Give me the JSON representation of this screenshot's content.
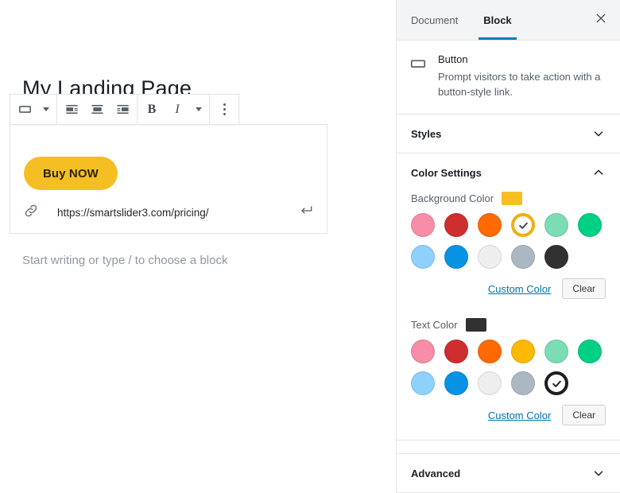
{
  "editor": {
    "post_title": "My Landing Page",
    "placeholder_text": "Start writing or type / to choose a block",
    "toolbar": {
      "block_type_icon": "button-block-icon",
      "block_type_caret_icon": "chevron-down-icon",
      "align_left_icon": "align-left-icon",
      "align_center_icon": "align-center-icon",
      "align_right_icon": "align-right-icon",
      "bold_label": "B",
      "italic_label": "I",
      "more_formatting_icon": "chevron-down-icon",
      "more_options_icon": "kebab-menu-icon"
    },
    "button_block": {
      "label": "Buy NOW",
      "background_color": "#f5bf23",
      "text_color": "#2b2300",
      "link_icon": "link-icon",
      "link_url": "https://smartslider3.com/pricing/",
      "link_submit_icon": "enter-arrow-icon"
    }
  },
  "sidebar": {
    "tabs": [
      {
        "label": "Document",
        "active": false
      },
      {
        "label": "Block",
        "active": true
      }
    ],
    "close_icon": "close-icon",
    "block_card": {
      "icon": "button-block-icon",
      "name": "Button",
      "description": "Prompt visitors to take action with a button-style link."
    },
    "panels": [
      {
        "label": "Styles",
        "expanded": false,
        "chevron_icon": "chevron-down-icon"
      },
      {
        "label": "Color Settings",
        "expanded": true,
        "chevron_icon": "chevron-up-icon"
      },
      {
        "label": "Advanced",
        "expanded": false,
        "chevron_icon": "chevron-down-icon"
      }
    ],
    "color_settings": {
      "background": {
        "label": "Background Color",
        "current_color": "#f5bf23",
        "swatches": [
          {
            "name": "pale-pink",
            "color": "#f78da7",
            "selected": false
          },
          {
            "name": "vivid-red",
            "color": "#cf2e2e",
            "selected": false
          },
          {
            "name": "luminous-orange",
            "color": "#ff6900",
            "selected": false
          },
          {
            "name": "luminous-amber",
            "color": "#eeae16",
            "selected": true
          },
          {
            "name": "light-green-cyan",
            "color": "#7bdcb5",
            "selected": false
          },
          {
            "name": "vivid-green-cyan",
            "color": "#00d084",
            "selected": false
          },
          {
            "name": "pale-cyan-blue",
            "color": "#8ed1fc",
            "selected": false
          },
          {
            "name": "vivid-cyan-blue",
            "color": "#0693e3",
            "selected": false
          },
          {
            "name": "very-light-gray",
            "color": "#eeeeee",
            "selected": false
          },
          {
            "name": "cyan-bluish-gray",
            "color": "#abb8c3",
            "selected": false
          },
          {
            "name": "very-dark-gray",
            "color": "#313131",
            "selected": false
          }
        ],
        "custom_color_label": "Custom Color",
        "clear_label": "Clear"
      },
      "text": {
        "label": "Text Color",
        "current_color": "#313131",
        "swatches": [
          {
            "name": "pale-pink",
            "color": "#f78da7",
            "selected": false
          },
          {
            "name": "vivid-red",
            "color": "#cf2e2e",
            "selected": false
          },
          {
            "name": "luminous-orange",
            "color": "#ff6900",
            "selected": false
          },
          {
            "name": "luminous-amber",
            "color": "#fcb900",
            "selected": false
          },
          {
            "name": "light-green-cyan",
            "color": "#7bdcb5",
            "selected": false
          },
          {
            "name": "vivid-green-cyan",
            "color": "#00d084",
            "selected": false
          },
          {
            "name": "pale-cyan-blue",
            "color": "#8ed1fc",
            "selected": false
          },
          {
            "name": "vivid-cyan-blue",
            "color": "#0693e3",
            "selected": false
          },
          {
            "name": "very-light-gray",
            "color": "#eeeeee",
            "selected": false
          },
          {
            "name": "cyan-bluish-gray",
            "color": "#abb8c3",
            "selected": false
          },
          {
            "name": "very-dark-gray",
            "color": "#1e1e1e",
            "selected": true
          }
        ],
        "custom_color_label": "Custom Color",
        "clear_label": "Clear"
      }
    },
    "accent_color": "#007cba"
  }
}
